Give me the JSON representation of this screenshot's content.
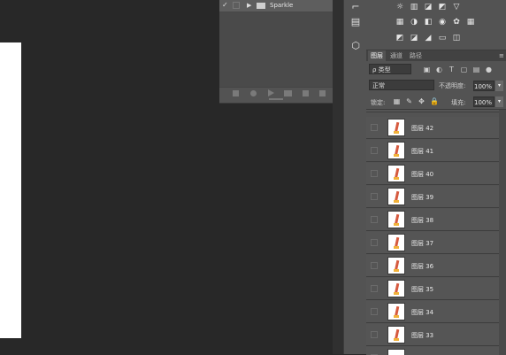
{
  "actions": {
    "item_label": "Sparkle",
    "check_glyph": "✓",
    "expand_glyph": "▶",
    "folder_icon": "folder-icon"
  },
  "layers_panel": {
    "tabs": [
      {
        "label": "图层",
        "active": true
      },
      {
        "label": "通道",
        "active": false
      },
      {
        "label": "路径",
        "active": false
      }
    ],
    "filter": {
      "value": "ρ 类型"
    },
    "blend_mode": {
      "value": "正常"
    },
    "opacity": {
      "label": "不透明度:",
      "value": "100%"
    },
    "lock": {
      "label": "锁定:"
    },
    "fill": {
      "label": "填充:",
      "value": "100%"
    },
    "layers": [
      {
        "name": "图层 42"
      },
      {
        "name": "图层 41"
      },
      {
        "name": "图层 40"
      },
      {
        "name": "图层 39"
      },
      {
        "name": "图层 38"
      },
      {
        "name": "图层 37"
      },
      {
        "name": "图层 36"
      },
      {
        "name": "图层 35"
      },
      {
        "name": "图层 34"
      },
      {
        "name": "图层 33"
      }
    ]
  },
  "colors": {
    "canvas_bg": "#282828",
    "panel_bg": "#535353",
    "document": "#ffffff",
    "thumb_shape": "#d65a3f"
  }
}
